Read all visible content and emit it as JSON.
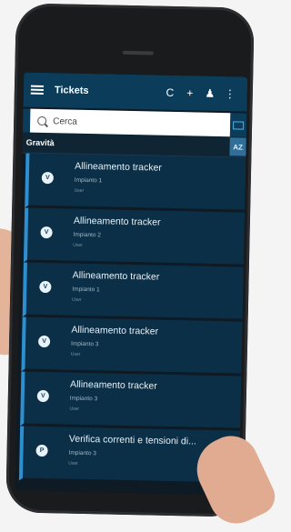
{
  "appbar": {
    "title": "Tickets",
    "actions": [
      "C",
      "+",
      "♂",
      ":"
    ]
  },
  "search": {
    "placeholder": "Cerca"
  },
  "group": {
    "label": "Gravità",
    "sort_label": "AZ"
  },
  "tickets": [
    {
      "badge": "V",
      "title": "Allineamento tracker",
      "plant": "Impianto 1",
      "user": "User"
    },
    {
      "badge": "V",
      "title": "Allineamento tracker",
      "plant": "Impianto 2",
      "user": "User"
    },
    {
      "badge": "V",
      "title": "Allineamento tracker",
      "plant": "Impianto 1",
      "user": "User"
    },
    {
      "badge": "V",
      "title": "Allineamento tracker",
      "plant": "Impianto 3",
      "user": "User"
    },
    {
      "badge": "V",
      "title": "Allineamento tracker",
      "plant": "Impianto 3",
      "user": "User"
    },
    {
      "badge": "P",
      "title": "Verifica correnti e tensioni di...",
      "plant": "Impianto 3",
      "user": "User"
    }
  ]
}
